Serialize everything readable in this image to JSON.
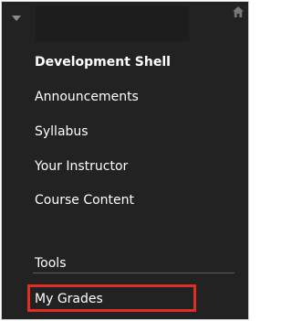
{
  "colors": {
    "panel_background": "#222222",
    "highlight_border": "#e22d25",
    "text": "#ffffff"
  },
  "topbar": {
    "collapse_icon": "caret-down-icon",
    "home_icon": "home-icon"
  },
  "course": {
    "title": "Development Shell"
  },
  "menu": {
    "items": [
      {
        "label": "Announcements"
      },
      {
        "label": "Syllabus"
      },
      {
        "label": "Your Instructor"
      },
      {
        "label": "Course Content"
      },
      {
        "label": "Tools"
      },
      {
        "label": "My Grades"
      }
    ]
  }
}
